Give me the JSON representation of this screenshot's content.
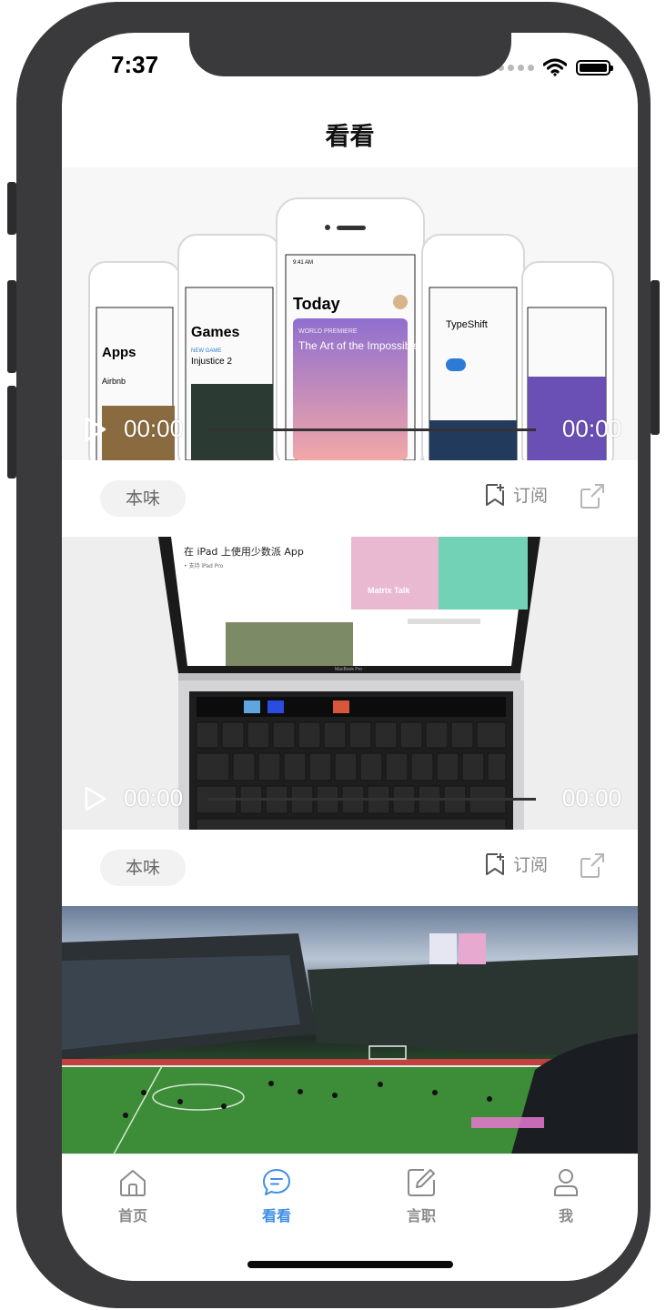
{
  "status": {
    "time": "7:37"
  },
  "nav": {
    "title": "看看"
  },
  "videos": [
    {
      "current_time": "00:00",
      "total_time": "00:00",
      "progress": 0,
      "tag": "本味",
      "subscribe_label": "订阅",
      "screen_texts": {
        "apps": "Apps",
        "games": "Games",
        "today": "Today",
        "typeshift": "TypeShift",
        "world_premiere": "WORLD PREMIERE",
        "feature_title": "The Art of the Impossible",
        "new_game": "NEW GAME",
        "injustice": "Injustice 2",
        "airbnb": "Airbnb",
        "clock": "9:41 AM"
      }
    },
    {
      "current_time": "00:00",
      "total_time": "00:00",
      "progress": 0,
      "tag": "本味",
      "subscribe_label": "订阅",
      "screen_texts": {
        "headline": "在 iPad 上使用少数派 App",
        "sub": "• 支持 iPad Pro",
        "matrix": "Matrix Talk",
        "brand": "MacBook Pro"
      }
    },
    {
      "current_time": "",
      "total_time": "",
      "progress": 0,
      "tag": "",
      "subscribe_label": ""
    }
  ],
  "tabs": [
    {
      "label": "首页",
      "icon": "home-icon",
      "active": false
    },
    {
      "label": "看看",
      "icon": "chat-bubble-icon",
      "active": true
    },
    {
      "label": "言职",
      "icon": "edit-icon",
      "active": false
    },
    {
      "label": "我",
      "icon": "user-icon",
      "active": false
    }
  ],
  "colors": {
    "accent": "#3e8ee8",
    "inactive": "#8a8a8a",
    "frame": "#3a3a3c"
  }
}
